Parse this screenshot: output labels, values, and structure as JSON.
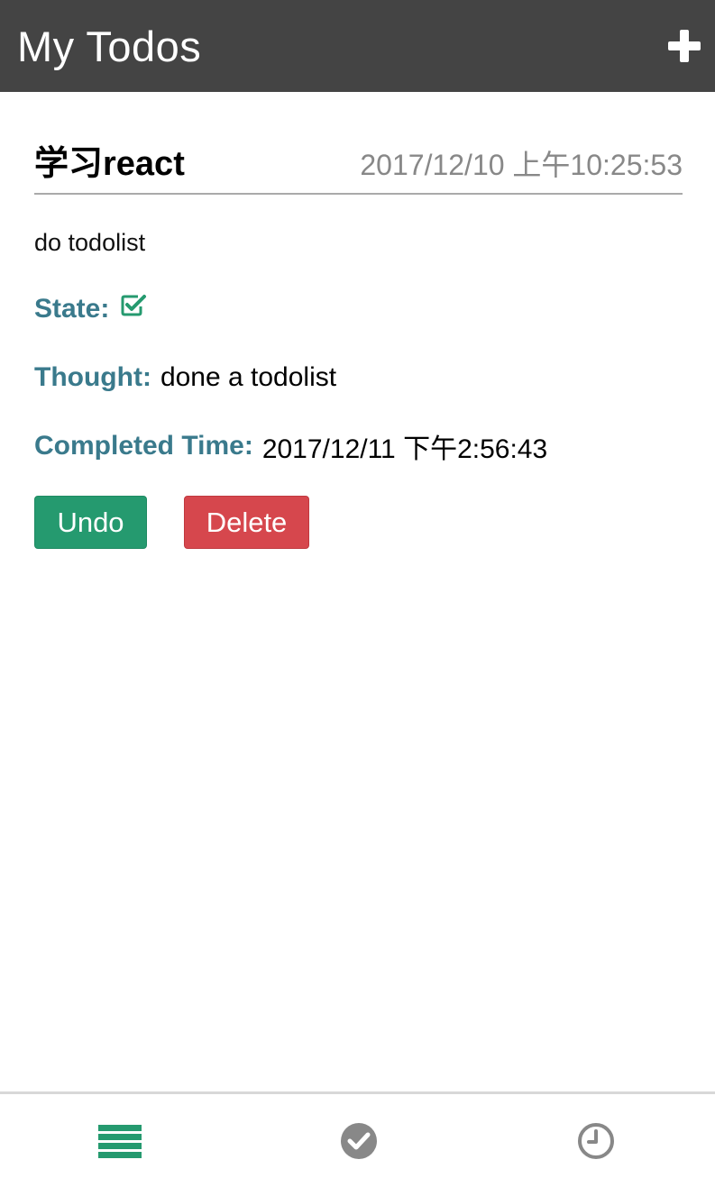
{
  "header": {
    "title": "My Todos",
    "add_icon": "plus-icon"
  },
  "todo": {
    "title": "学习react",
    "created": "2017/12/10 上午10:25:53",
    "description": "do todolist",
    "state_label": "State:",
    "state_icon": "checkbox-checked-icon",
    "thought_label": "Thought:",
    "thought_value": "done a todolist",
    "completed_label": "Completed Time:",
    "completed_value": "2017/12/11 下午2:56:43"
  },
  "actions": {
    "undo_label": "Undo",
    "delete_label": "Delete"
  },
  "tabs": [
    {
      "icon": "list-icon",
      "active": true
    },
    {
      "icon": "check-circle-icon",
      "active": false
    },
    {
      "icon": "clock-icon",
      "active": false
    }
  ],
  "colors": {
    "header_bg": "#444444",
    "accent_green": "#259a6f",
    "danger_red": "#d6474d",
    "label_teal": "#3a7a8c",
    "inactive_icon": "#888888"
  }
}
